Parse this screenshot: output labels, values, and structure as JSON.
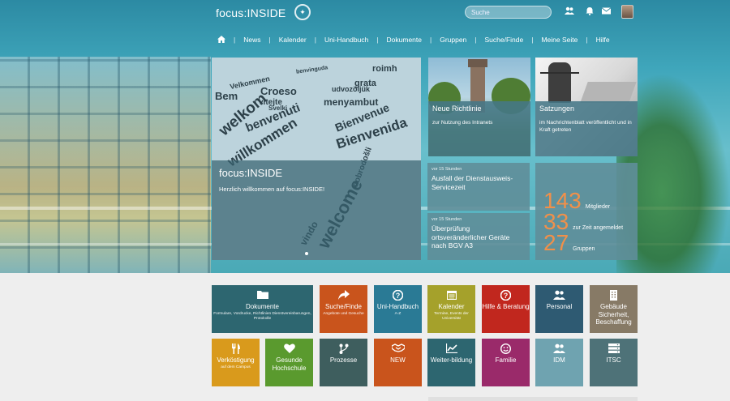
{
  "header": {
    "logo_text": "focus:INSIDE",
    "search_placeholder": "Suche",
    "icons": [
      "people-icon",
      "bell-icon",
      "mail-icon",
      "avatar"
    ]
  },
  "nav": {
    "items": [
      "Home",
      "News",
      "Kalender",
      "Uni-Handbuch",
      "Dokumente",
      "Gruppen",
      "Suche/Finde",
      "Meine Seite",
      "Hilfe"
    ]
  },
  "slider": {
    "title": "focus:INSIDE",
    "subtitle": "Herzlich willkommen auf focus:INSIDE!",
    "cloud_words": [
      "welkom",
      "willkommen",
      "benvenuti",
      "Bienvenue",
      "Bienvenida",
      "Croeso",
      "vitejte",
      "Velkommen",
      "grata",
      "menyambut",
      "roimh",
      "Bem",
      "welcome",
      "vindo",
      "benvinguda",
      "udvozöljük",
      "Svelki",
      "dobrodošli"
    ]
  },
  "tiles": {
    "richtlinie": {
      "title": "Neue Richtlinie",
      "desc": "zur Nutzung des Intranets"
    },
    "satzungen": {
      "title": "Satzungen",
      "desc": "im Nachrichtenblatt veröffentlicht und in Kraft getreten"
    }
  },
  "news": [
    {
      "time": "vor 15 Stunden",
      "headline": "Ausfall der Dienstausweis-Servicezeit"
    },
    {
      "time": "vor 15 Stunden",
      "headline": "Überprüfung ortsveränderlicher Geräte nach BGV A3"
    }
  ],
  "stats": [
    {
      "value": "143",
      "label": "Mitglieder"
    },
    {
      "value": "33",
      "label": "zur Zeit angemeldet"
    },
    {
      "value": "27",
      "label": "Gruppen"
    }
  ],
  "quick_tiles": [
    {
      "label": "Dokumente",
      "sub": "Formulare, Vordrucke, Richtlinien Dienstvereinbarungen, Protokolle",
      "color": "#2d6670",
      "icon": "folder-icon"
    },
    {
      "label": "Suche/Finde",
      "sub": "Angebote und Gesuche",
      "color": "#c9541c",
      "icon": "share-icon"
    },
    {
      "label": "Uni-Handbuch",
      "sub": "A-Z",
      "color": "#2a7a95",
      "icon": "question-icon"
    },
    {
      "label": "Kalender",
      "sub": "Termine, Events der Universität",
      "color": "#a5a12b",
      "icon": "calendar-icon"
    },
    {
      "label": "Hilfe & Beratung",
      "sub": "",
      "color": "#c1271e",
      "icon": "question-icon"
    },
    {
      "label": "Personal",
      "sub": "",
      "color": "#2e5a72",
      "icon": "people-icon"
    },
    {
      "label": "Gebäude Sicherheit, Beschaffung",
      "sub": "",
      "color": "#877a66",
      "icon": "building-icon"
    },
    {
      "label": "Verköstigung",
      "sub": "auf dem Campus",
      "color": "#d99a1c",
      "icon": "cutlery-icon"
    },
    {
      "label": "Gesunde Hochschule",
      "sub": "",
      "color": "#5a9a2e",
      "icon": "heart-icon"
    },
    {
      "label": "Prozesse",
      "sub": "",
      "color": "#3e5e5e",
      "icon": "flow-icon"
    },
    {
      "label": "NEW",
      "sub": "",
      "color": "#c9541c",
      "icon": "handshake-icon"
    },
    {
      "label": "Weiter-bildung",
      "sub": "",
      "color": "#2d6670",
      "icon": "chart-icon"
    },
    {
      "label": "Familie",
      "sub": "",
      "color": "#9a2a6a",
      "icon": "smile-icon"
    },
    {
      "label": "IDM",
      "sub": "",
      "color": "#6fa3b0",
      "icon": "people-icon"
    },
    {
      "label": "ITSC",
      "sub": "",
      "color": "#4e7278",
      "icon": "server-icon"
    }
  ]
}
